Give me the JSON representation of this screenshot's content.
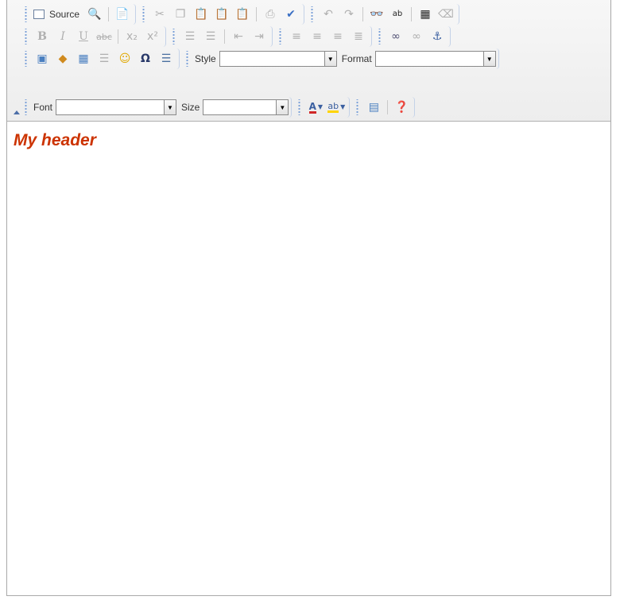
{
  "toolbar": {
    "source_label": "Source",
    "style_label": "Style",
    "style_value": "",
    "format_label": "Format",
    "format_value": "",
    "font_label": "Font",
    "font_value": "",
    "size_label": "Size",
    "size_value": ""
  },
  "content": {
    "header": "My header"
  },
  "colors": {
    "header": "#cc3300",
    "grip": "#7aa0d8",
    "toolbar_bg": "#efefef"
  }
}
